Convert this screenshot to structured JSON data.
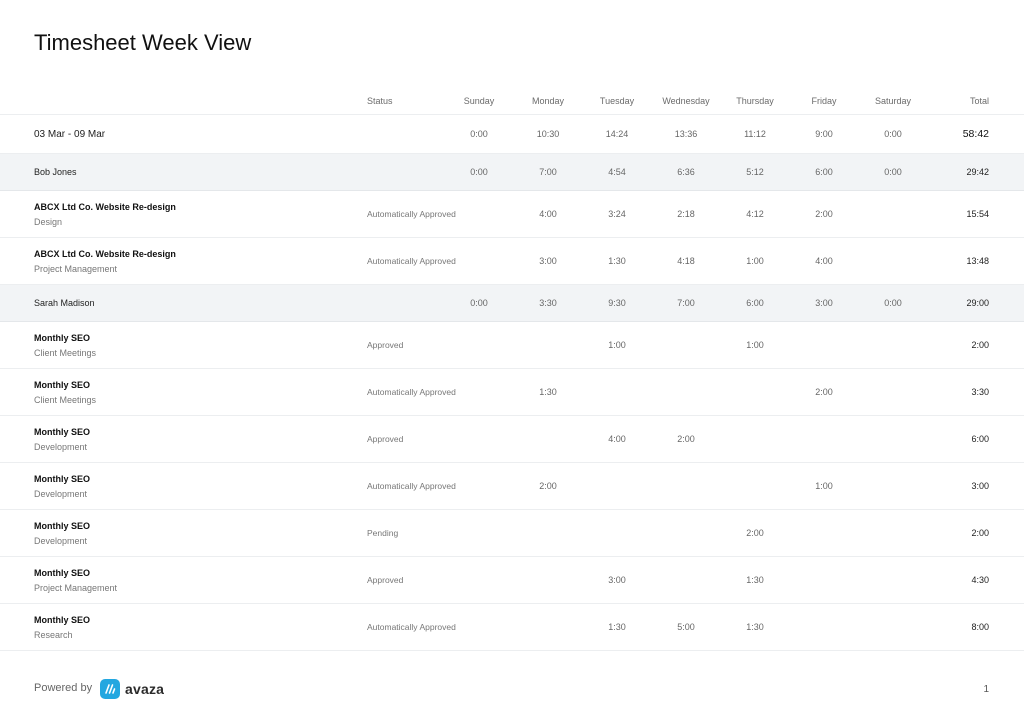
{
  "title": "Timesheet Week View",
  "columns": {
    "name": "",
    "status": "Status",
    "days": [
      "Sunday",
      "Monday",
      "Tuesday",
      "Wednesday",
      "Thursday",
      "Friday",
      "Saturday"
    ],
    "total": "Total"
  },
  "rows": [
    {
      "type": "week",
      "label": "03 Mar - 09 Mar",
      "days": [
        "0:00",
        "10:30",
        "14:24",
        "13:36",
        "11:12",
        "9:00",
        "0:00"
      ],
      "total": "58:42"
    },
    {
      "type": "person",
      "label": "Bob Jones",
      "days": [
        "0:00",
        "7:00",
        "4:54",
        "6:36",
        "5:12",
        "6:00",
        "0:00"
      ],
      "total": "29:42"
    },
    {
      "type": "entry",
      "project": "ABCX Ltd Co. Website Re-design",
      "task": "Design",
      "status": "Automatically Approved",
      "days": [
        "",
        "4:00",
        "3:24",
        "2:18",
        "4:12",
        "2:00",
        ""
      ],
      "total": "15:54"
    },
    {
      "type": "entry",
      "project": "ABCX Ltd Co. Website Re-design",
      "task": "Project Management",
      "status": "Automatically Approved",
      "days": [
        "",
        "3:00",
        "1:30",
        "4:18",
        "1:00",
        "4:00",
        ""
      ],
      "total": "13:48"
    },
    {
      "type": "person",
      "label": "Sarah Madison",
      "days": [
        "0:00",
        "3:30",
        "9:30",
        "7:00",
        "6:00",
        "3:00",
        "0:00"
      ],
      "total": "29:00"
    },
    {
      "type": "entry",
      "project": "Monthly SEO",
      "task": "Client Meetings",
      "status": "Approved",
      "days": [
        "",
        "",
        "1:00",
        "",
        "1:00",
        "",
        ""
      ],
      "total": "2:00"
    },
    {
      "type": "entry",
      "project": "Monthly SEO",
      "task": "Client Meetings",
      "status": "Automatically Approved",
      "days": [
        "",
        "1:30",
        "",
        "",
        "",
        "2:00",
        ""
      ],
      "total": "3:30"
    },
    {
      "type": "entry",
      "project": "Monthly SEO",
      "task": "Development",
      "status": "Approved",
      "days": [
        "",
        "",
        "4:00",
        "2:00",
        "",
        "",
        ""
      ],
      "total": "6:00"
    },
    {
      "type": "entry",
      "project": "Monthly SEO",
      "task": "Development",
      "status": "Automatically Approved",
      "days": [
        "",
        "2:00",
        "",
        "",
        "",
        "1:00",
        ""
      ],
      "total": "3:00"
    },
    {
      "type": "entry",
      "project": "Monthly SEO",
      "task": "Development",
      "status": "Pending",
      "days": [
        "",
        "",
        "",
        "",
        "2:00",
        "",
        ""
      ],
      "total": "2:00"
    },
    {
      "type": "entry",
      "project": "Monthly SEO",
      "task": "Project Management",
      "status": "Approved",
      "days": [
        "",
        "",
        "3:00",
        "",
        "1:30",
        "",
        ""
      ],
      "total": "4:30"
    },
    {
      "type": "entry",
      "project": "Monthly SEO",
      "task": "Research",
      "status": "Automatically Approved",
      "days": [
        "",
        "",
        "1:30",
        "5:00",
        "1:30",
        "",
        ""
      ],
      "total": "8:00"
    }
  ],
  "footer": {
    "powered_by": "Powered by",
    "brand": "avaza",
    "brand_color": "#23a7e0",
    "page_number": "1"
  }
}
